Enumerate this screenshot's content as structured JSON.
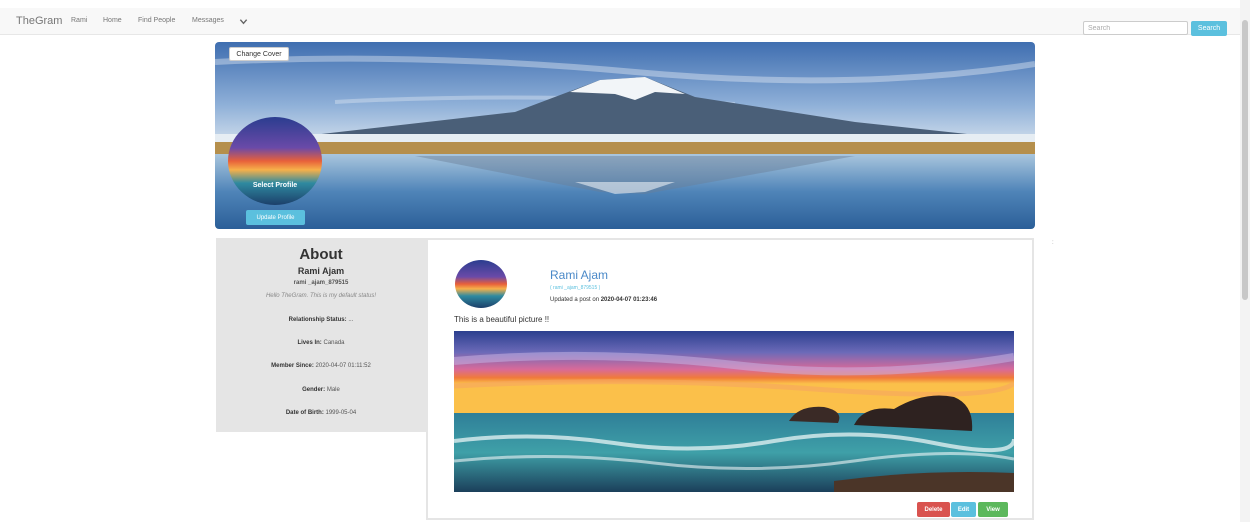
{
  "navbar": {
    "brand": "TheGram",
    "links": [
      "Rami",
      "Home",
      "Find People",
      "Messages"
    ],
    "search_placeholder": "Search",
    "search_button": "Search"
  },
  "cover": {
    "change_cover_label": "Change Cover",
    "select_profile_label": "Select Profile",
    "update_profile_label": "Update Profile"
  },
  "about": {
    "title": "About",
    "name": "Rami Ajam",
    "handle": "rami _ajam_879515",
    "status": "Hello TheGram. This is my default status!",
    "fields": [
      {
        "label": "Relationship Status:",
        "value": "..."
      },
      {
        "label": "Lives In:",
        "value": "Canada"
      },
      {
        "label": "Member Since:",
        "value": "2020-04-07 01:11:52"
      },
      {
        "label": "Gender:",
        "value": "Male"
      },
      {
        "label": "Date of Birth:",
        "value": "1999-05-04"
      }
    ]
  },
  "post": {
    "author": "Rami Ajam",
    "handle": "( rami _ajam_879515 )",
    "meta_prefix": "Updated a post on",
    "timestamp": "2020-04-07 01:23:46",
    "text": "This is a beautiful picture !!",
    "actions": {
      "delete": "Delete",
      "edit": "Edit",
      "view": "View"
    }
  },
  "colors": {
    "accent": "#5bc0de",
    "link": "#4a89c8",
    "danger": "#d9534f",
    "success": "#5cb85c"
  }
}
